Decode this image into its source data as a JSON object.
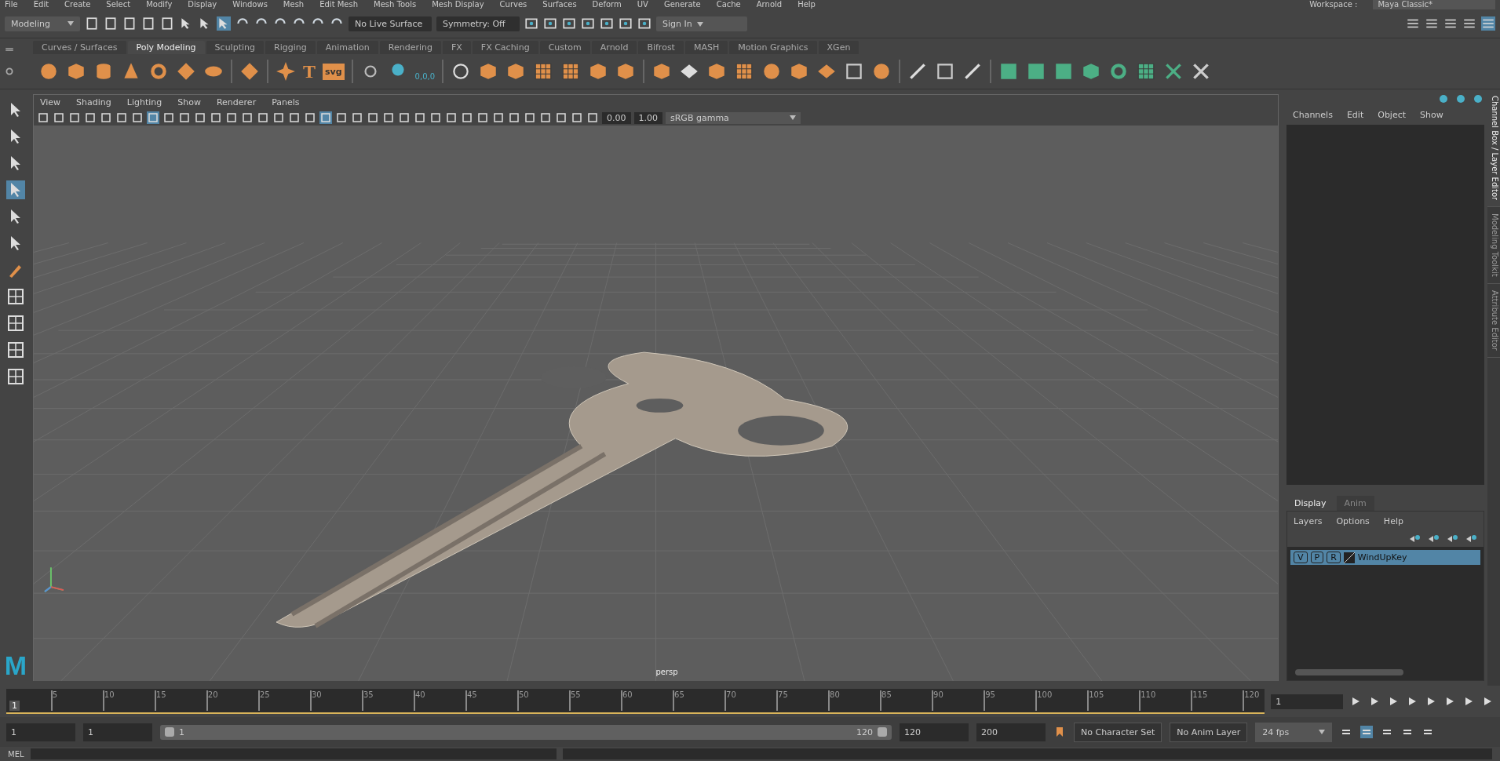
{
  "menu_bar": [
    "File",
    "Edit",
    "Create",
    "Select",
    "Modify",
    "Display",
    "Windows",
    "Mesh",
    "Edit Mesh",
    "Mesh Tools",
    "Mesh Display",
    "Curves",
    "Surfaces",
    "Deform",
    "UV",
    "Generate",
    "Cache",
    "Arnold",
    "Help"
  ],
  "workspace": {
    "label": "Workspace :",
    "value": "Maya Classic*"
  },
  "status_line": {
    "mode": "Modeling",
    "live_surface": "No Live Surface",
    "symmetry": "Symmetry: Off",
    "sign_in": "Sign In"
  },
  "shelf": {
    "tabs": [
      {
        "label": "Curves / Surfaces",
        "selected": false
      },
      {
        "label": "Poly Modeling",
        "selected": true
      },
      {
        "label": "Sculpting",
        "selected": false
      },
      {
        "label": "Rigging",
        "selected": false
      },
      {
        "label": "Animation",
        "selected": false
      },
      {
        "label": "Rendering",
        "selected": false
      },
      {
        "label": "FX",
        "selected": false
      },
      {
        "label": "FX Caching",
        "selected": false
      },
      {
        "label": "Custom",
        "selected": false
      },
      {
        "label": "Arnold",
        "selected": false
      },
      {
        "label": "Bifrost",
        "selected": false
      },
      {
        "label": "MASH",
        "selected": false
      },
      {
        "label": "Motion Graphics",
        "selected": false
      },
      {
        "label": "XGen",
        "selected": false
      }
    ],
    "text_tool": "T",
    "svg_tool": "svg",
    "snow_value": "0,0,0"
  },
  "viewport": {
    "menus": [
      "View",
      "Shading",
      "Lighting",
      "Show",
      "Renderer",
      "Panels"
    ],
    "exposure": "0.00",
    "gamma": "1.00",
    "color_space": "sRGB gamma",
    "camera": "persp"
  },
  "channel_box": {
    "menus": [
      "Channels",
      "Edit",
      "Object",
      "Show"
    ]
  },
  "side_tabs": [
    {
      "label": "Channel Box / Layer Editor",
      "selected": true
    },
    {
      "label": "Modeling Toolkit",
      "selected": false
    },
    {
      "label": "Attribute Editor",
      "selected": false
    }
  ],
  "layer_editor": {
    "tabs": [
      {
        "label": "Display",
        "selected": true
      },
      {
        "label": "Anim",
        "selected": false
      }
    ],
    "menus": [
      "Layers",
      "Options",
      "Help"
    ],
    "layers": [
      {
        "name": "WindUpKey",
        "selected": true,
        "flags": [
          "V",
          "P",
          "R"
        ]
      }
    ]
  },
  "timeline": {
    "ticks": [
      "5",
      "10",
      "15",
      "20",
      "25",
      "30",
      "35",
      "40",
      "45",
      "50",
      "55",
      "60",
      "65",
      "70",
      "75",
      "80",
      "85",
      "90",
      "95",
      "100",
      "105",
      "110",
      "115",
      "120"
    ],
    "current_frame": "1",
    "frame_field": "1",
    "level": 0
  },
  "range": {
    "start": "1",
    "inner_start": "1",
    "level": 1,
    "slider_start": "1",
    "slider_end": "120",
    "inner_end": "120",
    "end": "200",
    "character_set": "No Character Set",
    "anim_layer": "No Anim Layer",
    "fps": "24 fps"
  },
  "command_line": {
    "language": "MEL"
  },
  "logo": "M"
}
